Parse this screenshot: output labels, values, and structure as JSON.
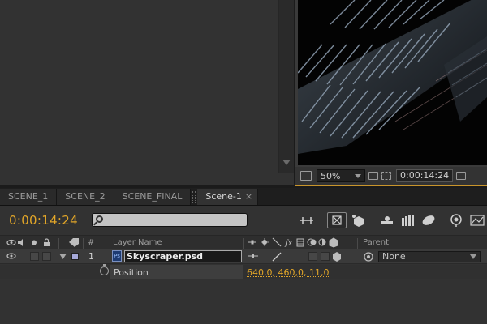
{
  "viewer": {
    "zoom": "50%",
    "time": "0:00:14:24"
  },
  "tabs": [
    {
      "label": "SCENE_1",
      "active": false
    },
    {
      "label": "SCENE_2",
      "active": false
    },
    {
      "label": "SCENE_FINAL",
      "active": false
    },
    {
      "label": "Scene-1",
      "active": true,
      "close": "×"
    }
  ],
  "timeline": {
    "current_time": "0:00:14:24",
    "search_placeholder": ""
  },
  "columns": {
    "layer_name": "Layer Name",
    "number": "#",
    "parent": "Parent"
  },
  "layer": {
    "number": "1",
    "name": "Skyscraper.psd",
    "type_badge": "Ps",
    "parent": "None",
    "label_color": "#a5a8d8"
  },
  "property": {
    "name": "Position",
    "value": "640,0, 460,0, 11,0"
  },
  "colors": {
    "accent": "#e2a628",
    "viewer_border": "#c9952b"
  }
}
